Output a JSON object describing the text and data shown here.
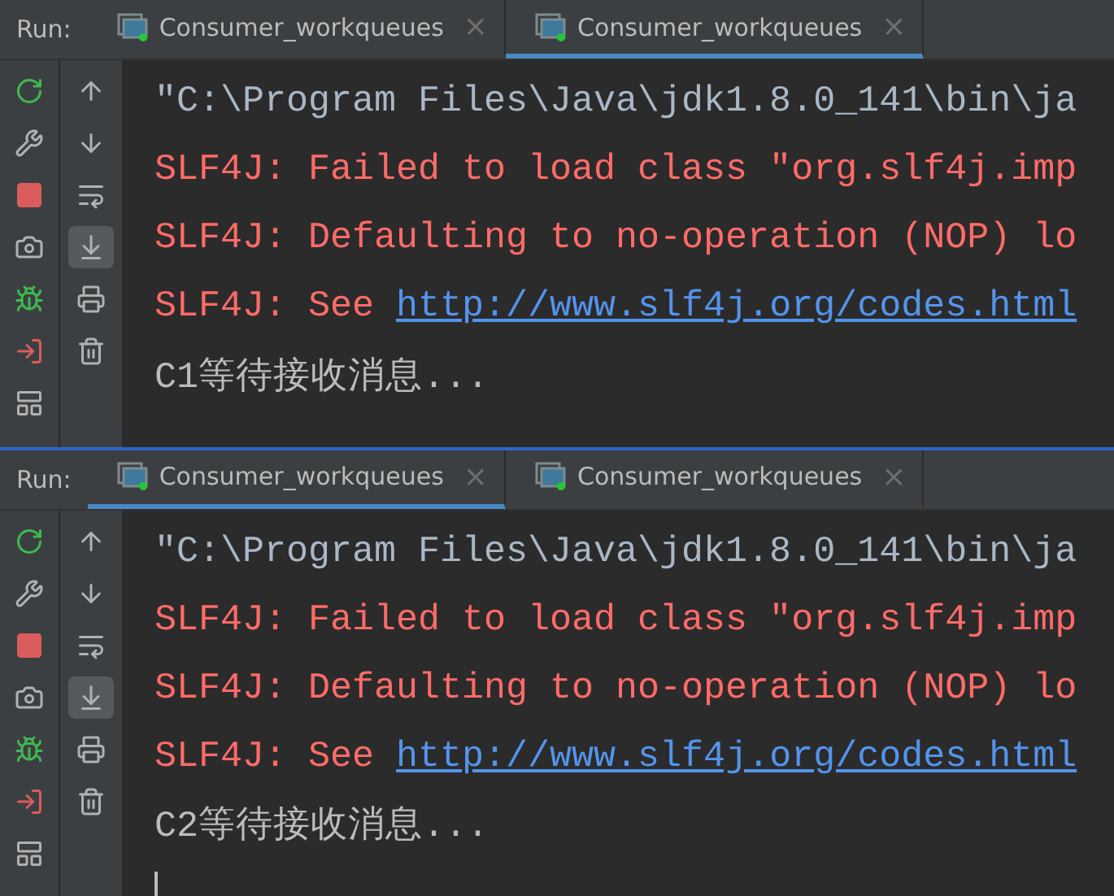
{
  "panels": [
    {
      "run_label": "Run:",
      "tabs": [
        {
          "label": "Consumer_workqueues",
          "selected": false,
          "close": "×"
        },
        {
          "label": "Consumer_workqueues",
          "selected": true,
          "close": "×"
        }
      ],
      "tools_left": [
        {
          "kind": "rerun"
        },
        {
          "kind": "settings"
        },
        {
          "kind": "stop"
        },
        {
          "kind": "camera"
        },
        {
          "kind": "debug"
        },
        {
          "kind": "exit"
        },
        {
          "kind": "layout"
        }
      ],
      "tools_right": [
        {
          "kind": "up",
          "selected": false
        },
        {
          "kind": "down",
          "selected": false
        },
        {
          "kind": "wrap",
          "selected": false
        },
        {
          "kind": "scroll-end",
          "selected": true
        },
        {
          "kind": "print",
          "selected": false
        },
        {
          "kind": "trash",
          "selected": false
        }
      ],
      "lines": [
        {
          "kind": "command",
          "text": "\"C:\\Program Files\\Java\\jdk1.8.0_141\\bin\\ja"
        },
        {
          "kind": "error",
          "text": "SLF4J: Failed to load class \"org.slf4j.imp"
        },
        {
          "kind": "error",
          "text": "SLF4J: Defaulting to no-operation (NOP) lo"
        },
        {
          "kind": "link",
          "text": "SLF4J: See ",
          "link": "http://www.slf4j.org/codes.html"
        },
        {
          "kind": "output",
          "text": "C1等待接收消息..."
        }
      ],
      "cursor": false
    },
    {
      "run_label": "Run:",
      "tabs": [
        {
          "label": "Consumer_workqueues",
          "selected": true,
          "close": "×"
        },
        {
          "label": "Consumer_workqueues",
          "selected": false,
          "close": "×"
        }
      ],
      "tools_left": [
        {
          "kind": "rerun"
        },
        {
          "kind": "settings"
        },
        {
          "kind": "stop"
        },
        {
          "kind": "camera"
        },
        {
          "kind": "debug"
        },
        {
          "kind": "exit"
        },
        {
          "kind": "layout"
        }
      ],
      "tools_right": [
        {
          "kind": "up",
          "selected": false
        },
        {
          "kind": "down",
          "selected": false
        },
        {
          "kind": "wrap",
          "selected": false
        },
        {
          "kind": "scroll-end",
          "selected": true
        },
        {
          "kind": "print",
          "selected": false
        },
        {
          "kind": "trash",
          "selected": false
        }
      ],
      "lines": [
        {
          "kind": "command",
          "text": "\"C:\\Program Files\\Java\\jdk1.8.0_141\\bin\\ja"
        },
        {
          "kind": "error",
          "text": "SLF4J: Failed to load class \"org.slf4j.imp"
        },
        {
          "kind": "error",
          "text": "SLF4J: Defaulting to no-operation (NOP) lo"
        },
        {
          "kind": "link",
          "text": "SLF4J: See ",
          "link": "http://www.slf4j.org/codes.html"
        },
        {
          "kind": "output",
          "text": "C2等待接收消息..."
        }
      ],
      "cursor": true
    }
  ]
}
